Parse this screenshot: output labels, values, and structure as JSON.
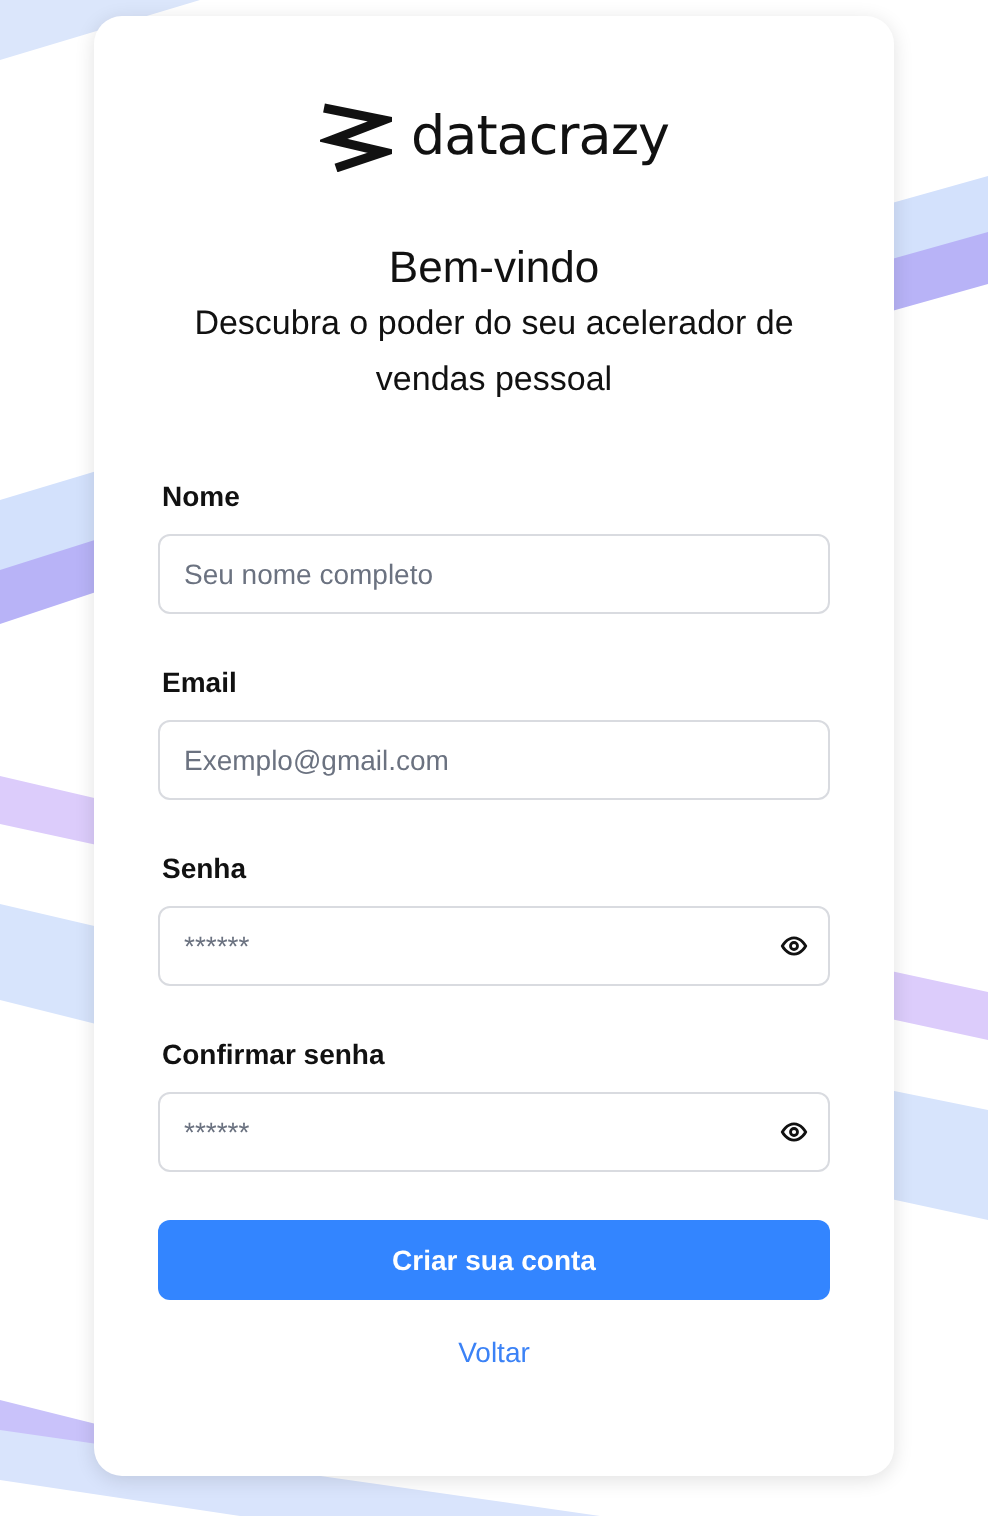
{
  "logo": {
    "text": "datacrazy"
  },
  "heading": {
    "title": "Bem-vindo",
    "subtitle": "Descubra o poder do seu acelerador de vendas pessoal"
  },
  "fields": [
    {
      "label": "Nome",
      "placeholder": "Seu nome completo",
      "kind": "text"
    },
    {
      "label": "Email",
      "placeholder": "Exemplo@gmail.com",
      "kind": "text"
    },
    {
      "label": "Senha",
      "placeholder": "******",
      "kind": "password"
    },
    {
      "label": "Confirmar senha",
      "placeholder": "******",
      "kind": "password"
    }
  ],
  "submit_button": "Criar sua conta",
  "back_link": "Voltar"
}
